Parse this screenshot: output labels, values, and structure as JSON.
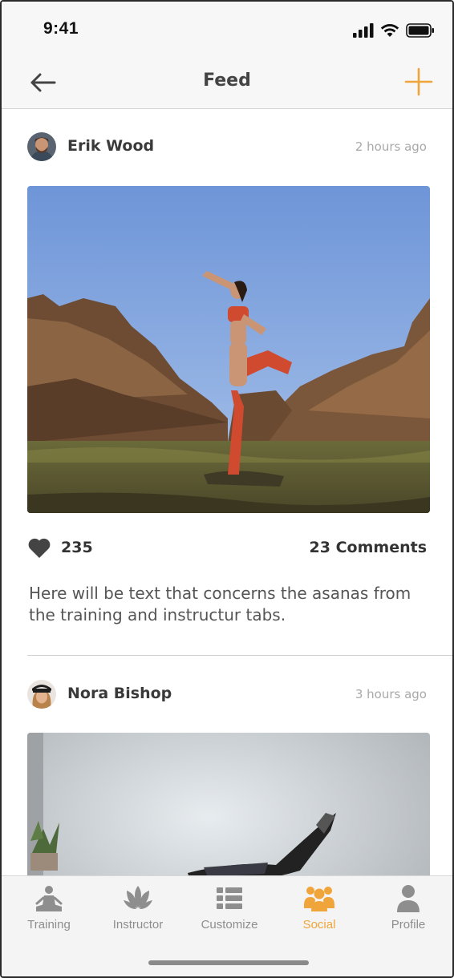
{
  "status_bar": {
    "time": "9:41"
  },
  "nav": {
    "title": "Feed",
    "back_icon": "arrow-left-icon",
    "add_icon": "plus-icon"
  },
  "colors": {
    "accent": "#f0a53a",
    "inactive": "#8e8e8e",
    "text": "#333333"
  },
  "posts": [
    {
      "author": "Erik Wood",
      "time": "2 hours ago",
      "likes": "235",
      "comments": "23 Comments",
      "caption": "Here will be text that concerns the asanas from the training and instructur tabs."
    },
    {
      "author": "Nora Bishop",
      "time": "3 hours ago"
    }
  ],
  "tabs": [
    {
      "label": "Training",
      "icon": "meditation-icon",
      "active": false
    },
    {
      "label": "Instructor",
      "icon": "lotus-icon",
      "active": false
    },
    {
      "label": "Customize",
      "icon": "list-icon",
      "active": false
    },
    {
      "label": "Social",
      "icon": "group-icon",
      "active": true
    },
    {
      "label": "Profile",
      "icon": "person-icon",
      "active": false
    }
  ]
}
